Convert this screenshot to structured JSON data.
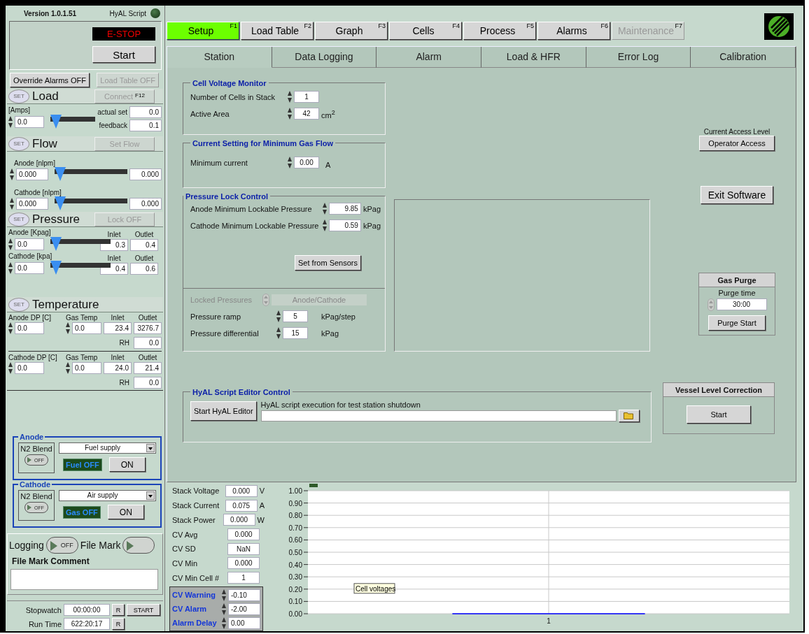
{
  "version": "Version 1.0.1.51",
  "script_indicator": {
    "label": "HyAL Script",
    "on": false
  },
  "estop": "E-STOP",
  "start_button": "Start",
  "override_button": {
    "label": "Override Alarms OFF",
    "disabled": false
  },
  "load_table_button": {
    "label": "Load Table OFF",
    "disabled": true
  },
  "load": {
    "set": "SET",
    "title": "Load",
    "button": {
      "label": "Connect",
      "key": "F12",
      "disabled": true
    },
    "unit": "[Amps]",
    "setpoint": "0.0",
    "level": 0,
    "actual_label": "actual set",
    "actual": "0.0",
    "feedback_label": "feedback",
    "feedback": "0.1"
  },
  "flow": {
    "set": "SET",
    "title": "Flow",
    "button": {
      "label": "Set Flow",
      "disabled": true
    },
    "rows": [
      {
        "label": "Anode [nlpm]",
        "setpoint": "0.000",
        "level": 0,
        "reading": "0.000"
      },
      {
        "label": "Cathode [nlpm]",
        "setpoint": "0.000",
        "level": 0,
        "reading": "0.000"
      }
    ]
  },
  "pressure": {
    "set": "SET",
    "title": "Pressure",
    "button": {
      "label": "Lock OFF",
      "disabled": true
    },
    "rows": [
      {
        "label": "Anode [Kpag]",
        "setpoint": "0.0",
        "level": 0,
        "inlet_label": "Inlet",
        "inlet": "0.3",
        "outlet_label": "Outlet",
        "outlet": "0.4"
      },
      {
        "label": "Cathode [kpa]",
        "setpoint": "0.0",
        "level": 0,
        "inlet_label": "Inlet",
        "inlet": "0.4",
        "outlet_label": "Outlet",
        "outlet": "0.6"
      }
    ]
  },
  "temperature": {
    "set": "SET",
    "title": "Temperature",
    "groups": [
      {
        "dp_label": "Anode DP [C]",
        "dp": "0.0",
        "gas_label": "Gas Temp",
        "gas": "0.0",
        "inlet_label": "Inlet",
        "inlet": "23.4",
        "outlet_label": "Outlet",
        "outlet": "3276.7",
        "rh_label": "RH",
        "rh": "0.0"
      },
      {
        "dp_label": "Cathode DP [C]",
        "dp": "0.0",
        "gas_label": "Gas Temp",
        "gas": "0.0",
        "inlet_label": "Inlet",
        "inlet": "24.0",
        "outlet_label": "Outlet",
        "outlet": "21.4",
        "rh_label": "RH",
        "rh": "0.0"
      }
    ]
  },
  "gas_supplies": [
    {
      "title": "Anode",
      "n2_label": "N2 Blend",
      "n2_toggle": "OFF",
      "n2_on": false,
      "supply": "Fuel supply",
      "status": "Fuel OFF",
      "on_button": "ON"
    },
    {
      "title": "Cathode",
      "n2_label": "N2 Blend",
      "n2_toggle": "OFF",
      "n2_on": false,
      "supply": "Air supply",
      "status": "Gas OFF",
      "on_button": "ON"
    }
  ],
  "logging": {
    "label": "Logging",
    "toggle": "OFF",
    "on": false,
    "file_mark": "File Mark",
    "file_mark_on": false,
    "comment_label": "File Mark Comment"
  },
  "stopwatch": {
    "label": "Stopwatch",
    "value": "00:00:00",
    "reset": "R",
    "start": "START"
  },
  "run_time": {
    "label": "Run Time",
    "value": "622:20:17",
    "reset": "R"
  },
  "function_keys": [
    {
      "label": "Setup",
      "key": "F1",
      "selected": true,
      "disabled": false
    },
    {
      "label": "Load Table",
      "key": "F2",
      "selected": false,
      "disabled": false
    },
    {
      "label": "Graph",
      "key": "F3",
      "selected": false,
      "disabled": false
    },
    {
      "label": "Cells",
      "key": "F4",
      "selected": false,
      "disabled": false
    },
    {
      "label": "Process",
      "key": "F5",
      "selected": false,
      "disabled": false
    },
    {
      "label": "Alarms",
      "key": "F6",
      "selected": false,
      "disabled": false
    },
    {
      "label": "Maintenance",
      "key": "F7",
      "selected": false,
      "disabled": true
    }
  ],
  "tabs": [
    {
      "label": "Station",
      "selected": true
    },
    {
      "label": "Data Logging",
      "selected": false
    },
    {
      "label": "Alarm",
      "selected": false
    },
    {
      "label": "Load & HFR",
      "selected": false
    },
    {
      "label": "Error Log",
      "selected": false
    },
    {
      "label": "Calibration",
      "selected": false
    }
  ],
  "cell_voltage_monitor": {
    "title": "Cell Voltage Monitor",
    "fields": [
      {
        "label": "Number of Cells in Stack",
        "value": "1"
      },
      {
        "label": "Active Area",
        "value": "42",
        "unit": "cm$^{2}$"
      }
    ]
  },
  "min_gas_flow": {
    "title": "Current Setting for Minimum Gas Flow",
    "fields": [
      {
        "label": "Minimum current",
        "value": "0.00",
        "unit": "A"
      }
    ]
  },
  "pressure_lock": {
    "title": "Pressure Lock Control",
    "fields": [
      {
        "label": "Anode Minimum Lockable Pressure",
        "value": "9.85",
        "unit": "kPag"
      },
      {
        "label": "Cathode Minimum Lockable Pressure",
        "value": "0.59",
        "unit": "kPag"
      }
    ],
    "button": "Set from Sensors",
    "locked": {
      "label": "Locked Pressures",
      "value": "Anode/Cathode",
      "disabled": true
    },
    "ramp_fields": [
      {
        "label": "Pressure ramp",
        "value": "5",
        "unit": "kPag/step"
      },
      {
        "label": "Pressure differential",
        "value": "15",
        "unit": "kPag"
      }
    ]
  },
  "access": {
    "label": "Current Access Level",
    "button": "Operator Access"
  },
  "exit_button": "Exit Software",
  "gas_purge": {
    "title": "Gas Purge",
    "label": "Purge time",
    "value": "30:00",
    "button": "Purge Start"
  },
  "script_editor": {
    "title": "HyAL Script Editor Control",
    "button": "Start HyAL Editor",
    "path_label": "HyAL script execution for test station shutdown"
  },
  "vessel": {
    "title": "Vessel Level Correction",
    "button": "Start"
  },
  "readouts": [
    {
      "label": "Stack Voltage",
      "value": "0.000",
      "unit": "V"
    },
    {
      "label": "Stack Current",
      "value": "0.075",
      "unit": "A"
    },
    {
      "label": "Stack Power",
      "value": "0.000",
      "unit": "W"
    },
    {
      "label": "CV Avg",
      "value": "0.000"
    },
    {
      "label": "CV SD",
      "value": "NaN"
    },
    {
      "label": "CV Min",
      "value": "0.000"
    },
    {
      "label": "CV Min Cell #",
      "value": "1"
    }
  ],
  "cv_limits": [
    {
      "label": "CV Warning",
      "value": "-0.10"
    },
    {
      "label": "CV Alarm",
      "value": "-2.00"
    },
    {
      "label": "Alarm Delay",
      "value": "0.00"
    }
  ],
  "chart": {
    "chart_data": {
      "type": "line",
      "grid": true,
      "series": [
        {
          "name": "Cell voltages",
          "color": "#0000ff",
          "values": [
            0,
            0
          ]
        }
      ],
      "annotations": [
        {
          "text": "1"
        }
      ],
      "ylim": [
        0,
        1
      ],
      "yticks": [
        {
          "value": 0,
          "label": "0.00"
        },
        {
          "value": 0.1,
          "label": "0.10"
        },
        {
          "value": 0.2,
          "label": "0.20"
        },
        {
          "value": 0.3,
          "label": "0.30"
        },
        {
          "value": 0.4,
          "label": "0.40"
        },
        {
          "value": 0.5,
          "label": "0.50"
        },
        {
          "value": 0.6,
          "label": "0.60"
        },
        {
          "value": 0.7,
          "label": "0.70"
        },
        {
          "value": 0.8,
          "label": "0.80"
        },
        {
          "value": 0.9,
          "label": "0.90"
        },
        {
          "value": 1,
          "label": "1.00"
        }
      ]
    }
  }
}
